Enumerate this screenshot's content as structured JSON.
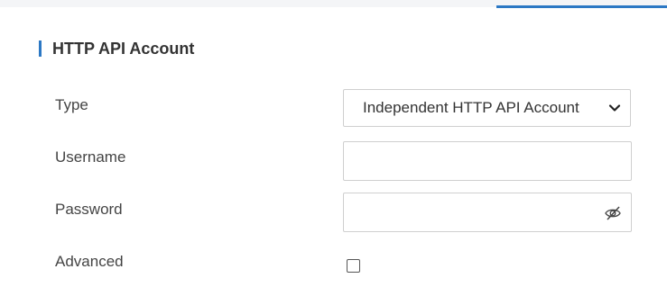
{
  "section": {
    "title": "HTTP API Account"
  },
  "form": {
    "type": {
      "label": "Type",
      "selected": "Independent HTTP API Account"
    },
    "username": {
      "label": "Username",
      "value": ""
    },
    "password": {
      "label": "Password",
      "value": "",
      "toggle_icon": "eye-hidden-icon"
    },
    "advanced": {
      "label": "Advanced",
      "checked": false
    }
  },
  "colors": {
    "accent": "#2c78c4",
    "border": "#cfcfcf",
    "text": "#333333"
  }
}
